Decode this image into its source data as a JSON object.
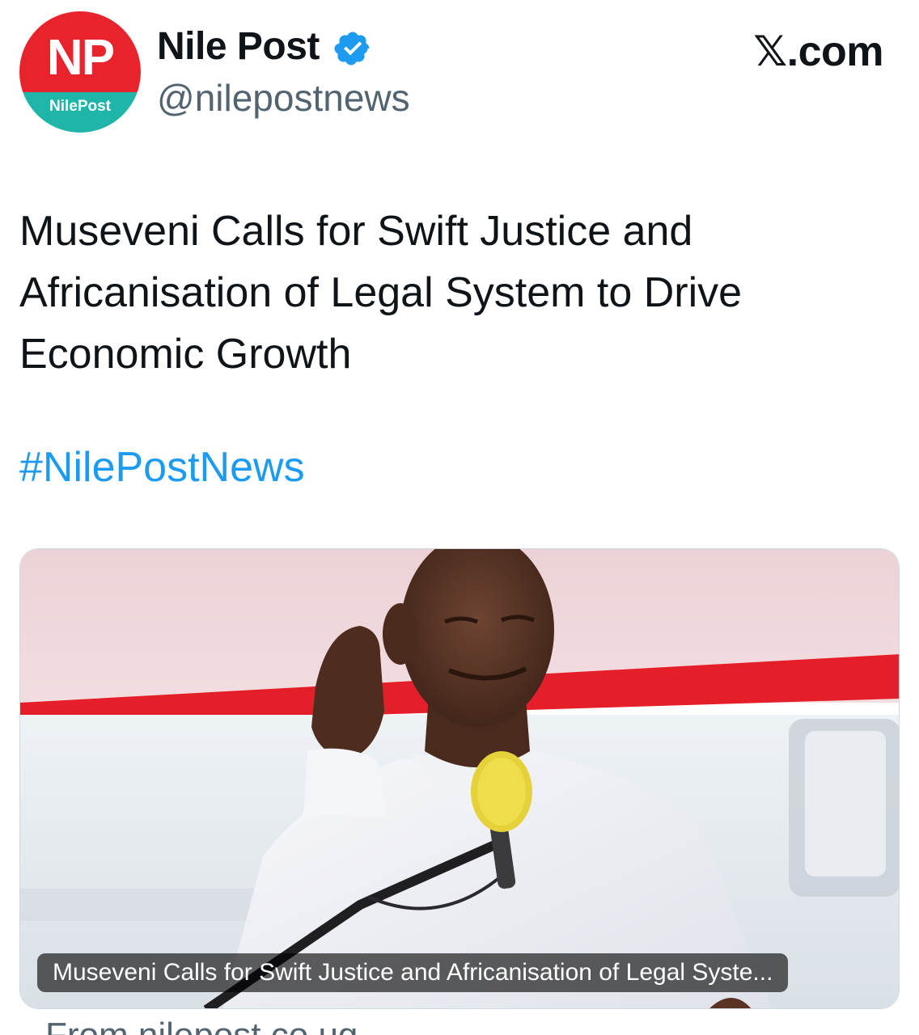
{
  "account": {
    "display_name": "Nile Post",
    "handle": "@nilepostnews",
    "verified": true,
    "avatar": {
      "logo_text": "NP",
      "sub_text": "NilePost",
      "colors": {
        "top": "#e8232b",
        "bottom": "#1fb5a8"
      }
    }
  },
  "brand": "𝕏.com",
  "tweet": {
    "text": "Museveni Calls for Swift Justice and Africanisation of Legal System to Drive Economic Growth",
    "hashtag": "#NilePostNews"
  },
  "card": {
    "caption": "Museveni Calls for Swift Justice and Africanisation of Legal Syste...",
    "source": "From nilepost.co.ug"
  },
  "colors": {
    "link": "#1d9bf0",
    "secondary_text": "#536471",
    "verified_badge": "#1d9bf0"
  },
  "icons": {
    "verified": "verified-badge-icon",
    "microphone": "microphone-icon"
  }
}
